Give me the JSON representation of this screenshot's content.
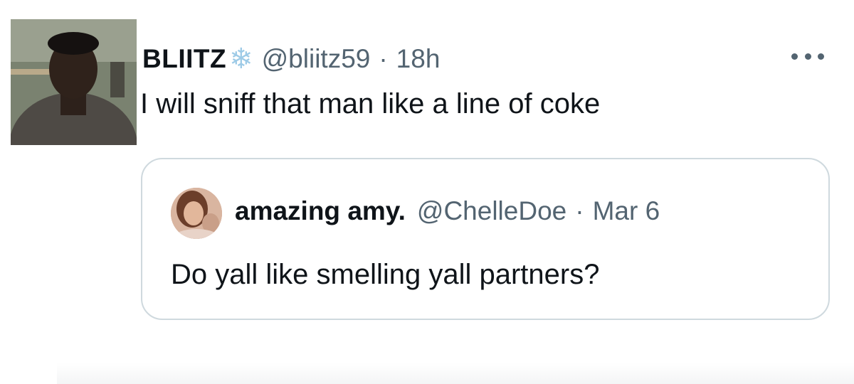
{
  "tweet": {
    "display_name": "BLIITZ",
    "name_emoji": "❄",
    "handle": "@bliitz59",
    "separator": "·",
    "time": "18h",
    "text": "I will sniff that man like a line of coke",
    "avatar_icon": "profile-photo"
  },
  "quoted_tweet": {
    "display_name": "amazing amy.",
    "handle": "@ChelleDoe",
    "separator": "·",
    "time": "Mar 6",
    "text": "Do yall like smelling yall partners?",
    "avatar_icon": "profile-photo"
  },
  "colors": {
    "primary_text": "#0f1419",
    "secondary_text": "#536471",
    "border": "#cfd9de",
    "snowflake": "#9ecbe7"
  }
}
